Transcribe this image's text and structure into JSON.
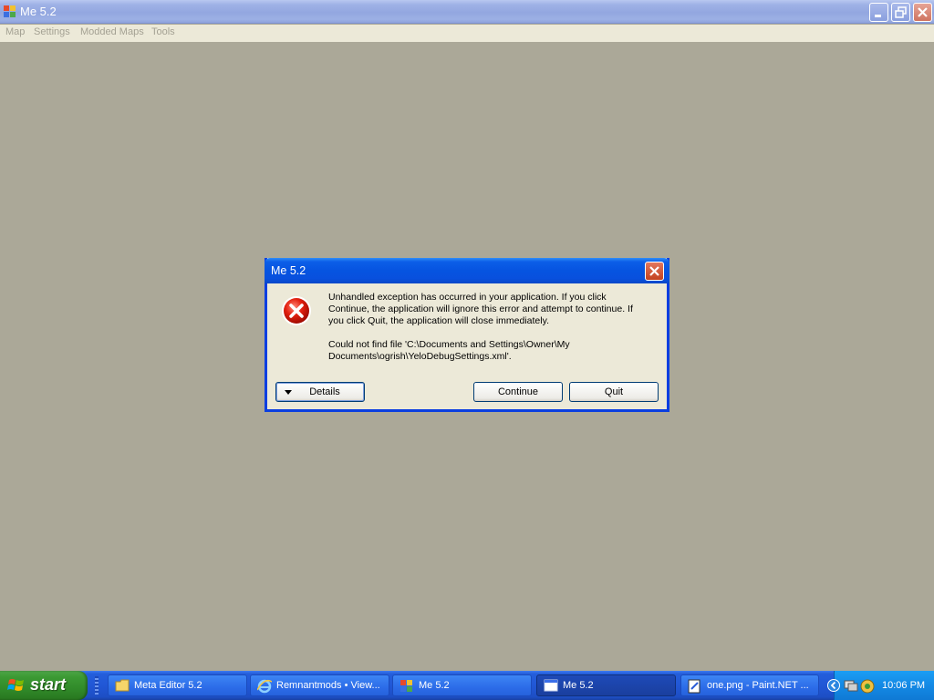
{
  "window": {
    "title": "Me 5.2",
    "menu": [
      "Map",
      "Settings",
      "Modded Maps",
      "Tools"
    ]
  },
  "dialog": {
    "title": "Me 5.2",
    "message_1": "Unhandled exception has occurred in your application. If you click Continue, the application will ignore this error and attempt to continue. If you click Quit, the application will close immediately.",
    "message_2": "Could not find file 'C:\\Documents and Settings\\Owner\\My Documents\\ogrish\\YeloDebugSettings.xml'.",
    "details_label": "Details",
    "continue_label": "Continue",
    "quit_label": "Quit",
    "icon": "error-icon"
  },
  "taskbar": {
    "start_label": "start",
    "tasks": [
      {
        "label": "Meta Editor 5.2",
        "icon": "folder-icon"
      },
      {
        "label": "Remnantmods • View...",
        "icon": "ie-icon"
      },
      {
        "label": "Me 5.2",
        "icon": "app-icon"
      },
      {
        "label": "Me 5.2",
        "icon": "window-icon",
        "active": true
      },
      {
        "label": "one.png - Paint.NET ...",
        "icon": "paint-icon"
      }
    ],
    "clock": "10:06 PM"
  },
  "colors": {
    "desktop": "#aba898",
    "dialog_title": "#0654e0",
    "taskbar": "#245edb",
    "start": "#318b2a"
  }
}
